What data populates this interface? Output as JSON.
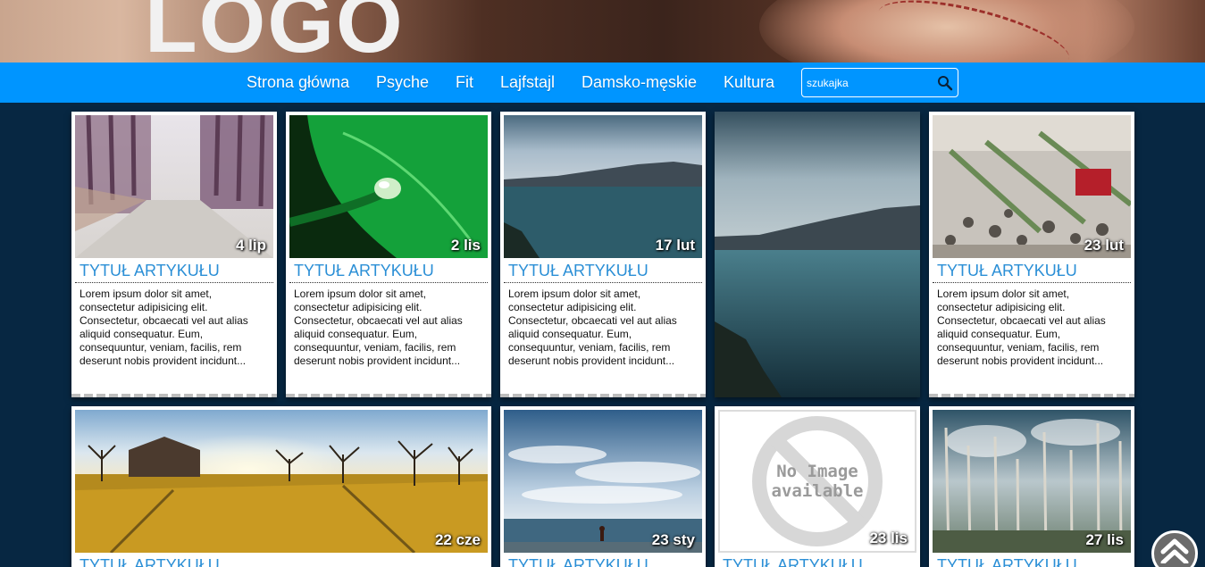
{
  "header": {
    "logo_text": "LOGO"
  },
  "nav": {
    "items": [
      {
        "label": "Strona główna"
      },
      {
        "label": "Psyche"
      },
      {
        "label": "Fit"
      },
      {
        "label": "Lajfstajl"
      },
      {
        "label": "Damsko-męskie"
      },
      {
        "label": "Kultura"
      }
    ],
    "search": {
      "placeholder": "szukajka"
    }
  },
  "row1": [
    {
      "date": "4 lip",
      "title": "TYTUŁ ARTYKUŁU",
      "text": "Lorem ipsum dolor sit amet, consectetur adipisicing elit. Consectetur, obcaecati vel aut alias aliquid consequatur. Eum, consequuntur, veniam, facilis, rem deserunt nobis provident incidunt..."
    },
    {
      "date": "2 lis",
      "title": "TYTUŁ ARTYKUŁU",
      "text": "Lorem ipsum dolor sit amet, consectetur adipisicing elit. Consectetur, obcaecati vel aut alias aliquid consequatur. Eum, consequuntur, veniam, facilis, rem deserunt nobis provident incidunt..."
    },
    {
      "date": "17 lut",
      "title": "TYTUŁ ARTYKUŁU",
      "text": "Lorem ipsum dolor sit amet, consectetur adipisicing elit. Consectetur, obcaecati vel aut alias aliquid consequatur. Eum, consequuntur, veniam, facilis, rem deserunt nobis provident incidunt..."
    },
    {
      "date": "",
      "title": "",
      "text": ""
    },
    {
      "date": "23 lut",
      "title": "TYTUŁ ARTYKUŁU",
      "text": "Lorem ipsum dolor sit amet, consectetur adipisicing elit. Consectetur, obcaecati vel aut alias aliquid consequatur. Eum, consequuntur, veniam, facilis, rem deserunt nobis provident incidunt..."
    }
  ],
  "row2": [
    {
      "date": "22 cze",
      "title": "TYTUŁ ARTYKUŁU"
    },
    {
      "date": "23 sty",
      "title": "TYTUŁ ARTYKUŁU"
    },
    {
      "date": "23 lis",
      "title": "TYTUŁ ARTYKUŁU",
      "no_image_line1": "No Image",
      "no_image_line2": "available"
    },
    {
      "date": "27 lis",
      "title": "TYTUŁ ARTYKUŁU"
    }
  ],
  "colors": {
    "nav": "#0095ff",
    "background": "#072742",
    "title": "#2b8fd6"
  }
}
